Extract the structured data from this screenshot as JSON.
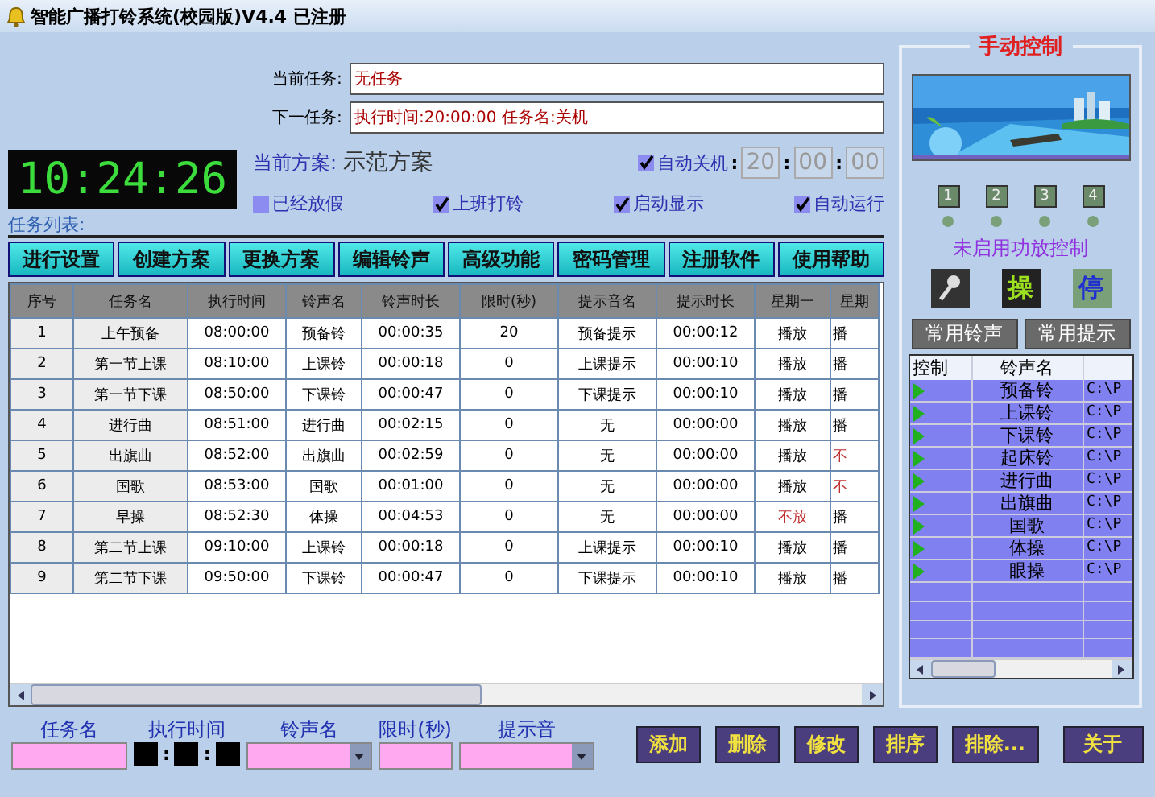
{
  "window": {
    "title": "智能广播打铃系统(校园版)V4.4 已注册"
  },
  "current_task": {
    "label": "当前任务:",
    "value": "无任务"
  },
  "next_task": {
    "label": "下一任务:",
    "value": "执行时间:20:00:00 任务名:关机"
  },
  "clock": "10:24:26",
  "scheme": {
    "label": "当前方案:",
    "value": "示范方案"
  },
  "auto_shutdown": {
    "label": "自动关机",
    "checked": true,
    "separator": ":",
    "hour": "20",
    "minute": "00",
    "second": "00"
  },
  "options": [
    {
      "label": "已经放假",
      "checked": false
    },
    {
      "label": "上班打铃",
      "checked": true
    },
    {
      "label": "启动显示",
      "checked": true
    },
    {
      "label": "自动运行",
      "checked": true
    }
  ],
  "task_list_label": "任务列表:",
  "toolbar": [
    "进行设置",
    "创建方案",
    "更换方案",
    "编辑铃声",
    "高级功能",
    "密码管理",
    "注册软件",
    "使用帮助"
  ],
  "table": {
    "columns": [
      "序号",
      "任务名",
      "执行时间",
      "铃声名",
      "铃声时长",
      "限时(秒)",
      "提示音名",
      "提示时长",
      "星期一",
      "星期"
    ],
    "rows": [
      {
        "cells": [
          "1",
          "上午预备",
          "08:00:00",
          "预备铃",
          "00:00:35",
          "20",
          "预备提示",
          "00:00:12"
        ],
        "mon": {
          "text": "播放",
          "play": true
        },
        "col10": {
          "text": "播",
          "play": true
        }
      },
      {
        "cells": [
          "2",
          "第一节上课",
          "08:10:00",
          "上课铃",
          "00:00:18",
          "0",
          "上课提示",
          "00:00:10"
        ],
        "mon": {
          "text": "播放",
          "play": true
        },
        "col10": {
          "text": "播",
          "play": true
        }
      },
      {
        "cells": [
          "3",
          "第一节下课",
          "08:50:00",
          "下课铃",
          "00:00:47",
          "0",
          "下课提示",
          "00:00:10"
        ],
        "mon": {
          "text": "播放",
          "play": true
        },
        "col10": {
          "text": "播",
          "play": true
        }
      },
      {
        "cells": [
          "4",
          "进行曲",
          "08:51:00",
          "进行曲",
          "00:02:15",
          "0",
          "无",
          "00:00:00"
        ],
        "mon": {
          "text": "播放",
          "play": true
        },
        "col10": {
          "text": "播",
          "play": true
        }
      },
      {
        "cells": [
          "5",
          "出旗曲",
          "08:52:00",
          "出旗曲",
          "00:02:59",
          "0",
          "无",
          "00:00:00"
        ],
        "mon": {
          "text": "播放",
          "play": true
        },
        "col10": {
          "text": "不",
          "play": false
        }
      },
      {
        "cells": [
          "6",
          "国歌",
          "08:53:00",
          "国歌",
          "00:01:00",
          "0",
          "无",
          "00:00:00"
        ],
        "mon": {
          "text": "播放",
          "play": true
        },
        "col10": {
          "text": "不",
          "play": false
        }
      },
      {
        "cells": [
          "7",
          "早操",
          "08:52:30",
          "体操",
          "00:04:53",
          "0",
          "无",
          "00:00:00"
        ],
        "mon": {
          "text": "不放",
          "play": false
        },
        "col10": {
          "text": "播",
          "play": true
        }
      },
      {
        "cells": [
          "8",
          "第二节上课",
          "09:10:00",
          "上课铃",
          "00:00:18",
          "0",
          "上课提示",
          "00:00:10"
        ],
        "mon": {
          "text": "播放",
          "play": true
        },
        "col10": {
          "text": "播",
          "play": true
        }
      },
      {
        "cells": [
          "9",
          "第二节下课",
          "09:50:00",
          "下课铃",
          "00:00:47",
          "0",
          "下课提示",
          "00:00:10"
        ],
        "mon": {
          "text": "播放",
          "play": true
        },
        "col10": {
          "text": "播",
          "play": true
        }
      }
    ]
  },
  "form": {
    "labels": [
      "任务名",
      "执行时间",
      "铃声名",
      "限时(秒)",
      "提示音"
    ],
    "time_separator": ":"
  },
  "actions": [
    "添加",
    "删除",
    "修改",
    "排序",
    "排除...",
    "关于"
  ],
  "manual": {
    "title": "手动控制",
    "channels": [
      "1",
      "2",
      "3",
      "4"
    ],
    "status": "未启用功放控制",
    "op_key": "操",
    "stop_key": "停",
    "tabs": [
      "常用铃声",
      "常用提示"
    ],
    "list": {
      "columns": [
        "控制",
        "铃声名"
      ],
      "rows": [
        {
          "name": "预备铃",
          "path": "C:\\P"
        },
        {
          "name": "上课铃",
          "path": "C:\\P"
        },
        {
          "name": "下课铃",
          "path": "C:\\P"
        },
        {
          "name": "起床铃",
          "path": "C:\\P"
        },
        {
          "name": "进行曲",
          "path": "C:\\P"
        },
        {
          "name": "出旗曲",
          "path": "C:\\P"
        },
        {
          "name": "国歌",
          "path": "C:\\P"
        },
        {
          "name": "体操",
          "path": "C:\\P"
        },
        {
          "name": "眼操",
          "path": "C:\\P"
        }
      ]
    }
  }
}
